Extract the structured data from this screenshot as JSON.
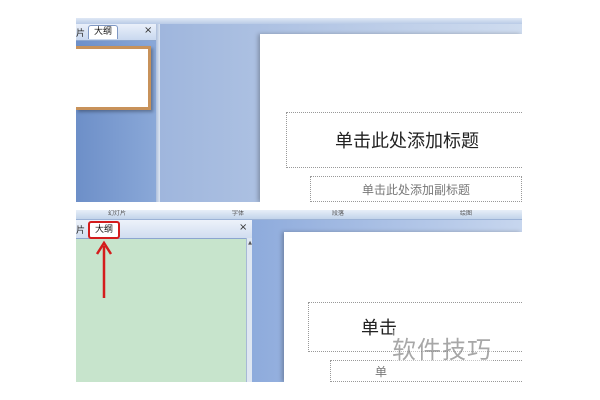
{
  "top": {
    "pane_tabs": {
      "slides": "片",
      "outline": "大纲",
      "close": "×"
    },
    "slide": {
      "title_placeholder": "单击此处添加标题",
      "subtitle_placeholder": "单击此处添加副标题"
    }
  },
  "bottom": {
    "ribbon_labels": [
      "幻灯片",
      "字体",
      "段落",
      "绘图"
    ],
    "pane_tabs": {
      "slides": "片",
      "outline": "大纲",
      "close": "×"
    },
    "slide": {
      "title_placeholder_partial": "单击",
      "subtitle_placeholder_partial": "单"
    },
    "highlight_color": "#d41c1c"
  },
  "watermark": "软件技巧"
}
